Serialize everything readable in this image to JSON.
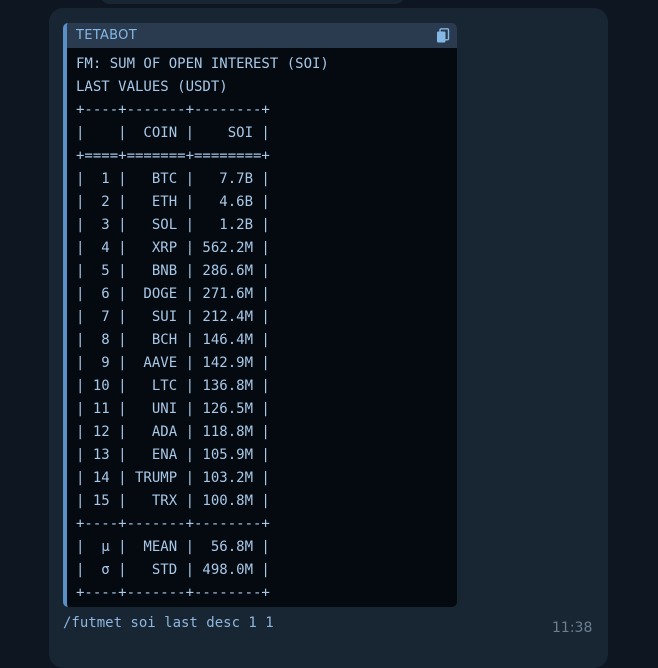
{
  "message": {
    "code_language": "TETABOT",
    "code_lines": [
      "FM: SUM OF OPEN INTEREST (SOI)",
      "LAST VALUES (USDT)",
      "+----+-------+--------+",
      "|    |  COIN |    SOI |",
      "+====+=======+========+",
      "|  1 |   BTC |   7.7B |",
      "|  2 |   ETH |   4.6B |",
      "|  3 |   SOL |   1.2B |",
      "|  4 |   XRP | 562.2M |",
      "|  5 |   BNB | 286.6M |",
      "|  6 |  DOGE | 271.6M |",
      "|  7 |   SUI | 212.4M |",
      "|  8 |   BCH | 146.4M |",
      "|  9 |  AAVE | 142.9M |",
      "| 10 |   LTC | 136.8M |",
      "| 11 |   UNI | 126.5M |",
      "| 12 |   ADA | 118.8M |",
      "| 13 |   ENA | 105.9M |",
      "| 14 | TRUMP | 103.2M |",
      "| 15 |   TRX | 100.8M |",
      "+----+-------+--------+",
      "|  μ |  MEAN |  56.8M |",
      "|  σ |   STD | 498.0M |",
      "+----+-------+--------+"
    ],
    "command": "/futmet soi last desc 1 1",
    "time": "11:38"
  },
  "colors": {
    "background": "#0e1621",
    "bubble": "#182533",
    "code_bg": "#050a10",
    "code_header": "#2a3a4f",
    "code_accent": "#5a90c8",
    "code_text": "#a8c8e8",
    "time_text": "#6d7f8f"
  },
  "icons": {
    "copy": "copy-icon"
  }
}
